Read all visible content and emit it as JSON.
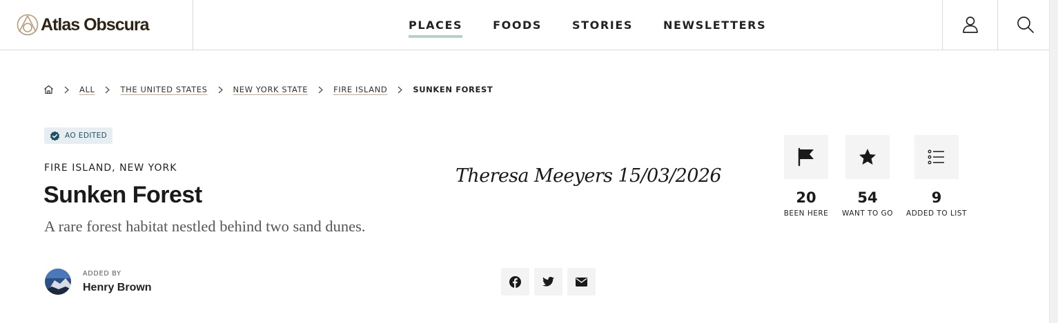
{
  "header": {
    "logo_text": "Atlas Obscura",
    "nav": [
      {
        "label": "PLACES",
        "active": true
      },
      {
        "label": "FOODS",
        "active": false
      },
      {
        "label": "STORIES",
        "active": false
      },
      {
        "label": "NEWSLETTERS",
        "active": false
      }
    ],
    "icons": [
      "user-icon",
      "search-icon"
    ]
  },
  "breadcrumb": {
    "links": [
      "ALL",
      "THE UNITED STATES",
      "NEW YORK STATE",
      "FIRE ISLAND"
    ],
    "current": "SUNKEN FOREST"
  },
  "badge": {
    "label": "AO EDITED",
    "color": "#1f4f63"
  },
  "place": {
    "location": "FIRE ISLAND, NEW YORK",
    "title": "Sunken Forest",
    "subtitle": "A rare forest habitat nestled behind two sand dunes."
  },
  "signature": "Theresa Meeyers 15/03/2026",
  "stats": [
    {
      "icon": "flag-icon",
      "count": "20",
      "label": "BEEN HERE"
    },
    {
      "icon": "star-icon",
      "count": "54",
      "label": "WANT TO GO"
    },
    {
      "icon": "list-icon",
      "count": "9",
      "label": "ADDED TO LIST"
    }
  ],
  "added_by": {
    "label": "ADDED BY",
    "name": "Henry Brown"
  },
  "share": [
    "facebook-icon",
    "twitter-icon",
    "email-icon"
  ],
  "colors": {
    "nav_active_underline": "#b8d0c9",
    "link_underline": "#c9a98a",
    "logo": "#2d2416"
  }
}
